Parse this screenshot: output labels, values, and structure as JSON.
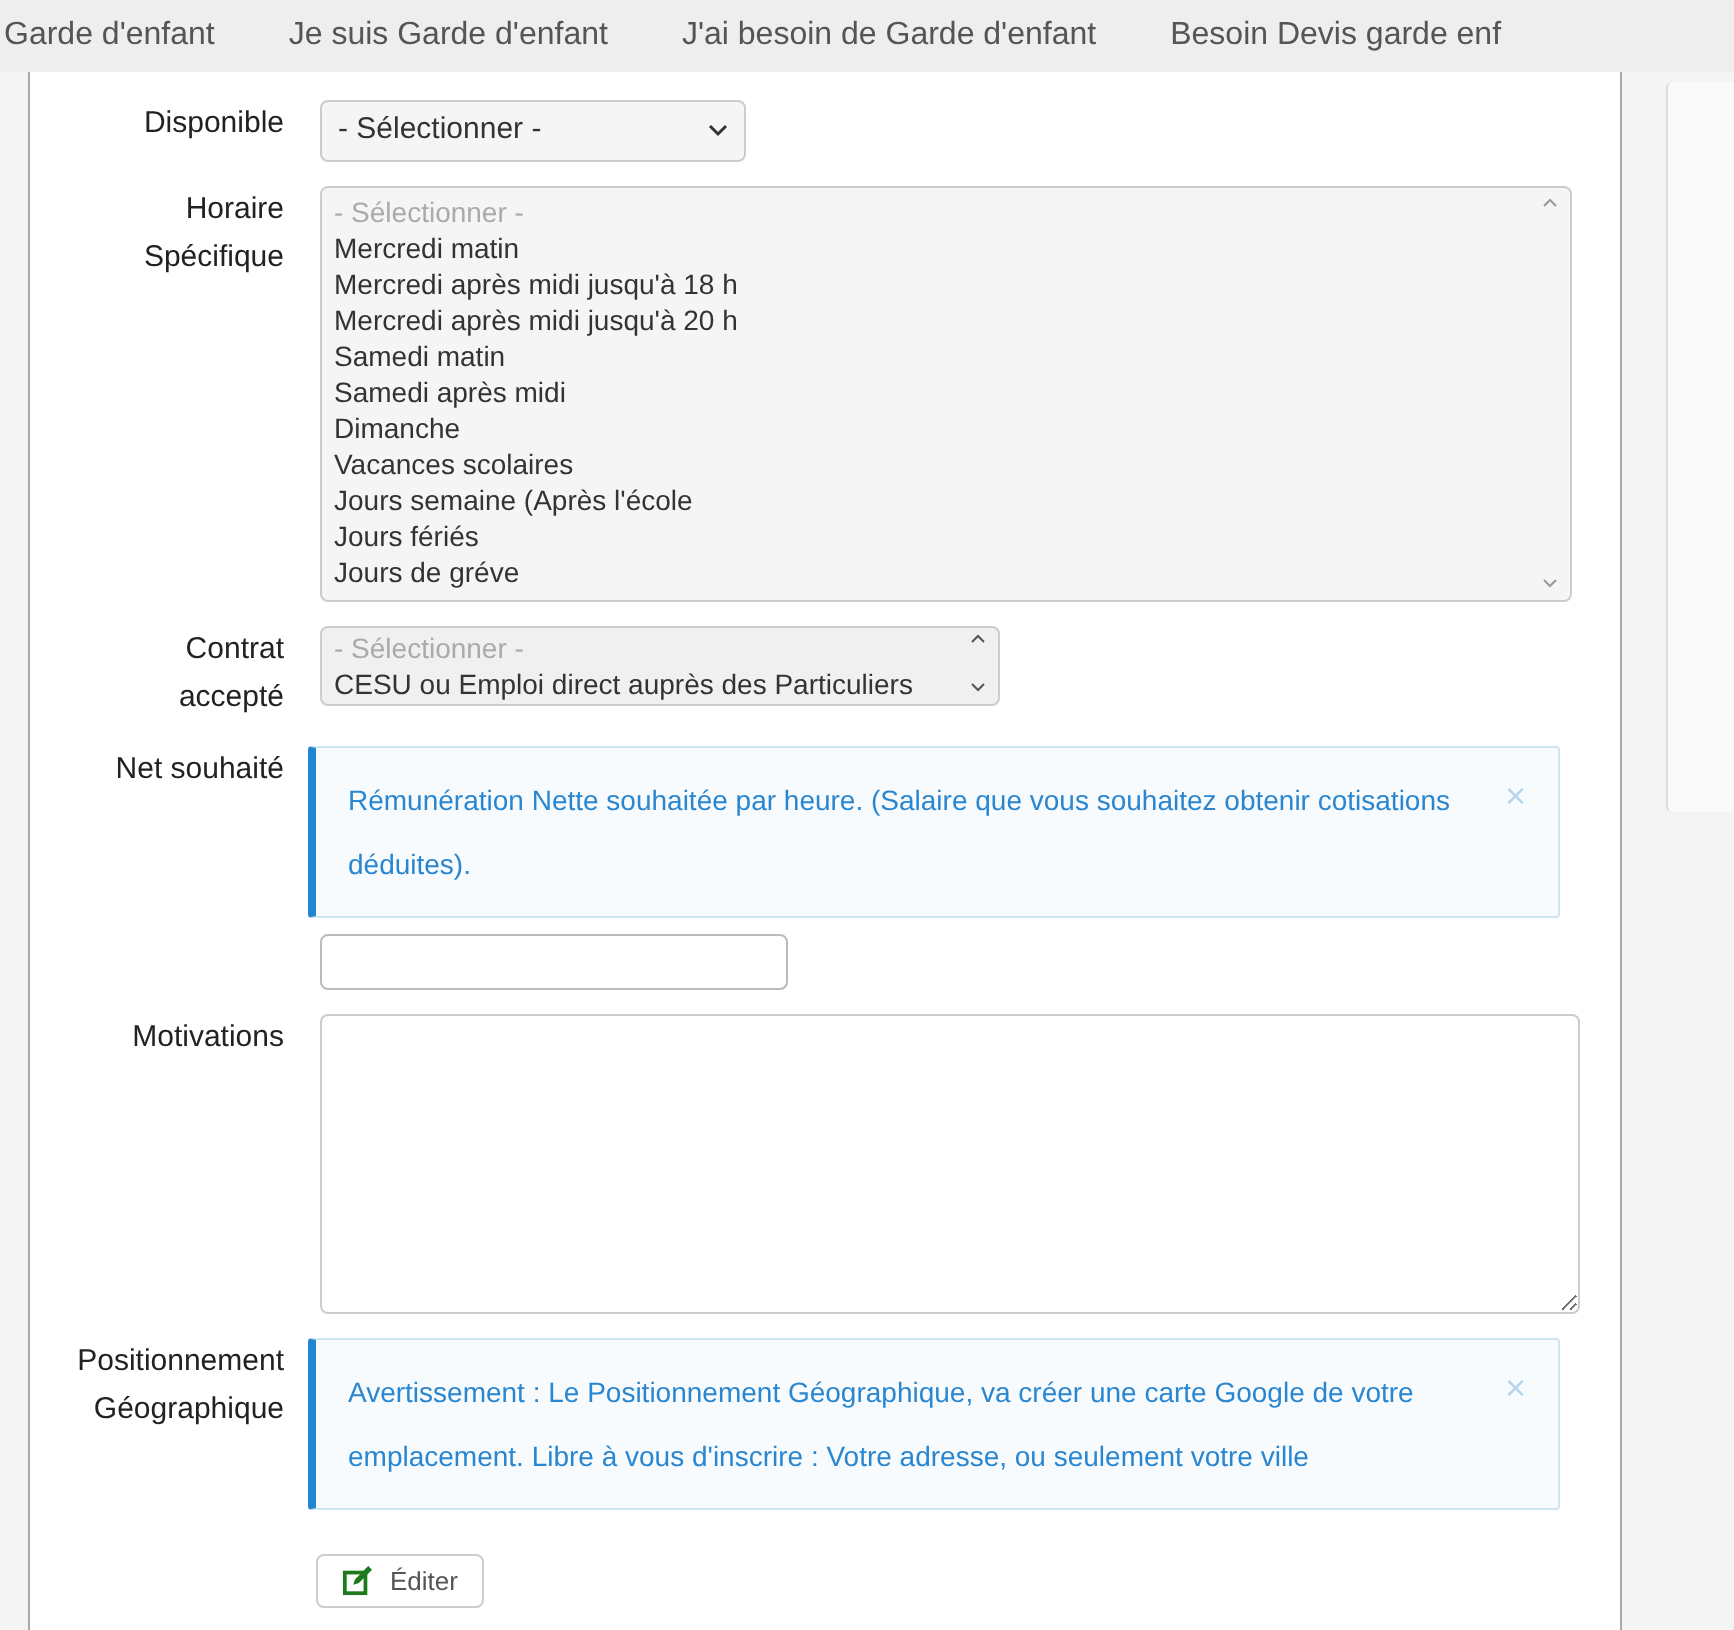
{
  "nav": {
    "items": [
      "Garde d'enfant",
      "Je suis Garde d'enfant",
      "J'ai besoin de Garde d'enfant",
      "Besoin Devis garde enf"
    ]
  },
  "form": {
    "disponible": {
      "label": "Disponible",
      "value": "- Sélectionner -"
    },
    "horaire": {
      "label": [
        "Horaire",
        "Spécifique"
      ],
      "placeholder": "- Sélectionner -",
      "options": [
        "Mercredi matin",
        "Mercredi après midi jusqu'à 18 h",
        "Mercredi après midi jusqu'à 20 h",
        "Samedi matin",
        "Samedi après midi",
        "Dimanche",
        "Vacances scolaires",
        "Jours semaine (Après l'école",
        "Jours fériés",
        "Jours de gréve"
      ]
    },
    "contrat": {
      "label": [
        "Contrat",
        "accepté"
      ],
      "placeholder": "- Sélectionner -",
      "options": [
        "CESU ou Emploi direct auprès des Particuliers"
      ]
    },
    "net": {
      "label": "Net souhaité",
      "alert": "Rémunération Nette souhaitée par heure. (Salaire que vous souhaitez obtenir cotisations déduites).",
      "close": "×"
    },
    "motivations": {
      "label": "Motivations"
    },
    "geo": {
      "label": [
        "Positionnement",
        "Géographique"
      ],
      "alert": "Avertissement : Le Positionnement Géographique, va créer une carte Google de votre emplacement. Libre à vous d'inscrire : Votre adresse, ou seulement votre ville",
      "close": "×"
    },
    "submit": {
      "label": "Éditer"
    }
  }
}
